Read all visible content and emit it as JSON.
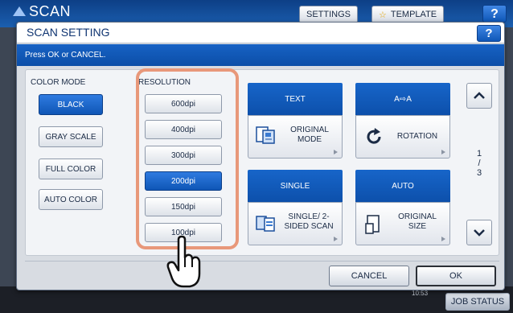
{
  "background": {
    "app_title": "SCAN",
    "tabs": [
      "SETTINGS",
      "TEMPLATE"
    ],
    "help_label": "?",
    "time": "10:53",
    "job_status": "JOB STATUS"
  },
  "dialog": {
    "title": "SCAN SETTING",
    "help_label": "?",
    "message": "Press OK or CANCEL."
  },
  "color_mode": {
    "label": "COLOR MODE",
    "options": [
      "BLACK",
      "GRAY SCALE",
      "FULL COLOR",
      "AUTO COLOR"
    ],
    "selected": "BLACK"
  },
  "resolution": {
    "label": "RESOLUTION",
    "options": [
      "600dpi",
      "400dpi",
      "300dpi",
      "200dpi",
      "150dpi",
      "100dpi"
    ],
    "selected": "200dpi"
  },
  "functions": {
    "original_mode": {
      "value": "TEXT",
      "label_line1": "ORIGINAL",
      "label_line2": "MODE"
    },
    "rotation": {
      "value": "A⇨A",
      "label": "ROTATION"
    },
    "single_sided": {
      "value": "SINGLE",
      "label_line1": "SINGLE/ 2-",
      "label_line2": "SIDED SCAN"
    },
    "original_size": {
      "value": "AUTO",
      "label_line1": "ORIGINAL",
      "label_line2": "SIZE"
    }
  },
  "pagination": {
    "current": "1",
    "separator": "/",
    "total": "3"
  },
  "footer": {
    "cancel_label": "CANCEL",
    "ok_label": "OK"
  },
  "colors": {
    "accent": "#0f56b6",
    "highlight_frame": "#e8987a"
  }
}
